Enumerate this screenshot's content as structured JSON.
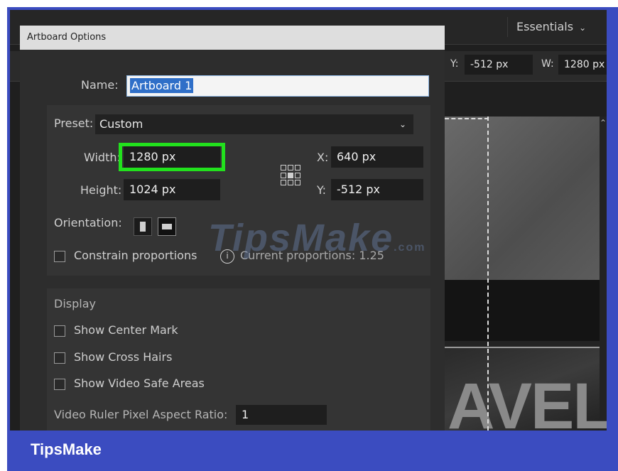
{
  "header": {
    "workspace_label": "Essentials",
    "y_label": "Y:",
    "y_value": "-512 px",
    "w_label": "W:",
    "w_value": "1280 px"
  },
  "canvas": {
    "artwork_text": "AVEL"
  },
  "dialog": {
    "title": "Artboard Options",
    "name_label": "Name:",
    "name_value": "Artboard 1",
    "preset_label": "Preset:",
    "preset_value": "Custom",
    "width_label": "Width:",
    "width_value": "1280 px",
    "height_label": "Height:",
    "height_value": "1024 px",
    "x_label": "X:",
    "x_value": "640 px",
    "y_label": "Y:",
    "y_value": "-512 px",
    "orientation_label": "Orientation:",
    "constrain_label": "Constrain proportions",
    "current_proportions": "Current proportions: 1.25",
    "display_label": "Display",
    "show_center_mark": "Show Center Mark",
    "show_cross_hairs": "Show Cross Hairs",
    "show_video_safe": "Show Video Safe Areas",
    "pixel_ratio_label": "Video Ruler Pixel Aspect Ratio:",
    "pixel_ratio_value": "1"
  },
  "watermark": {
    "text": "TipsMake",
    "suffix": ".com"
  },
  "footer": {
    "brand": "TipsMake"
  },
  "colors": {
    "frame": "#3b4cc0",
    "highlight": "#22e11d",
    "selection": "#2f6fc8"
  }
}
